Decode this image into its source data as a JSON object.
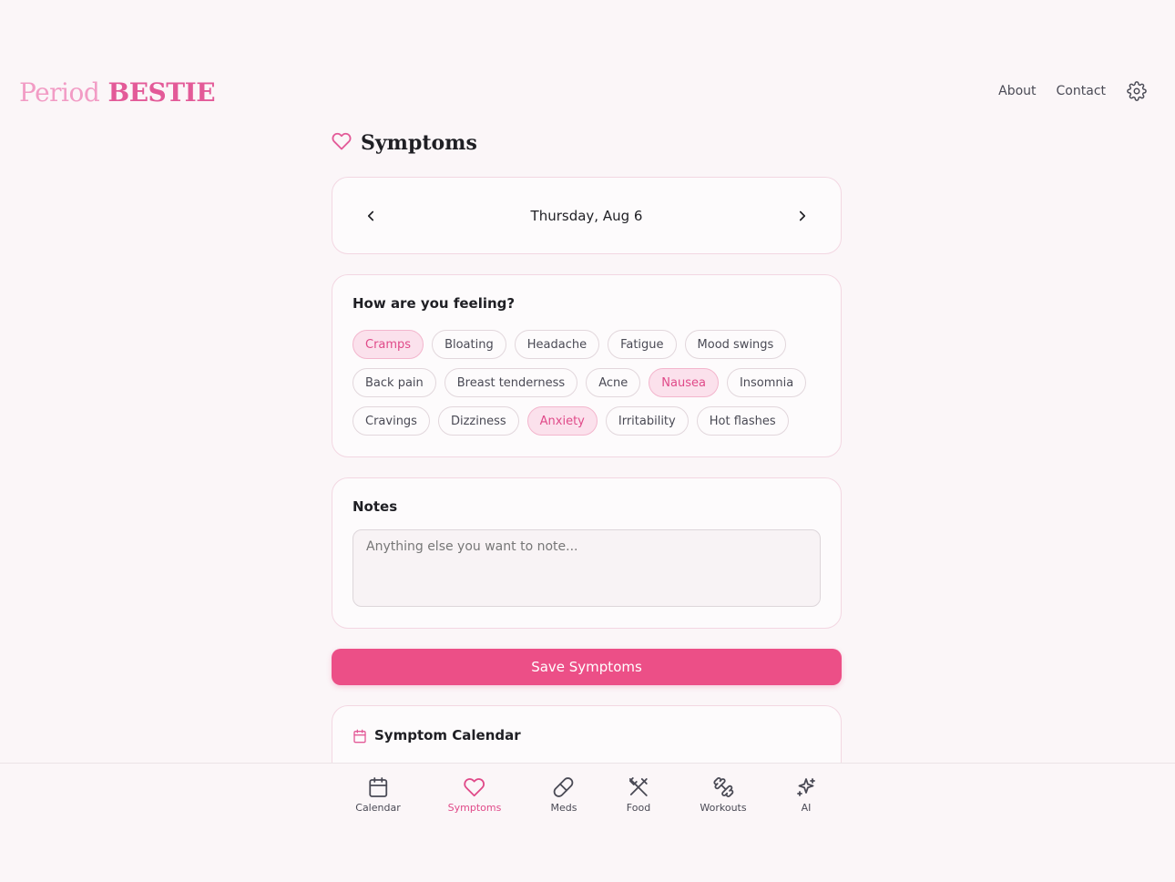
{
  "brand": {
    "part1": "Period",
    "part2": "BESTIE"
  },
  "topnav": {
    "about": "About",
    "contact": "Contact"
  },
  "page": {
    "title": "Symptoms"
  },
  "date_picker": {
    "date": "Thursday, Aug 6"
  },
  "feeling": {
    "title": "How are you feeling?",
    "symptoms": [
      {
        "label": "Cramps",
        "selected": true
      },
      {
        "label": "Bloating",
        "selected": false
      },
      {
        "label": "Headache",
        "selected": false
      },
      {
        "label": "Fatigue",
        "selected": false
      },
      {
        "label": "Mood swings",
        "selected": false
      },
      {
        "label": "Back pain",
        "selected": false
      },
      {
        "label": "Breast tenderness",
        "selected": false
      },
      {
        "label": "Acne",
        "selected": false
      },
      {
        "label": "Nausea",
        "selected": true
      },
      {
        "label": "Insomnia",
        "selected": false
      },
      {
        "label": "Cravings",
        "selected": false
      },
      {
        "label": "Dizziness",
        "selected": false
      },
      {
        "label": "Anxiety",
        "selected": true
      },
      {
        "label": "Irritability",
        "selected": false
      },
      {
        "label": "Hot flashes",
        "selected": false
      }
    ]
  },
  "notes": {
    "title": "Notes",
    "placeholder": "Anything else you want to note...",
    "value": ""
  },
  "save_button": {
    "label": "Save Symptoms"
  },
  "symptom_calendar": {
    "title": "Symptom Calendar"
  },
  "bottom_nav": [
    {
      "label": "Calendar",
      "icon": "calendar-icon",
      "active": false
    },
    {
      "label": "Symptoms",
      "icon": "heart-icon",
      "active": true
    },
    {
      "label": "Meds",
      "icon": "pill-icon",
      "active": false
    },
    {
      "label": "Food",
      "icon": "utensils-icon",
      "active": false
    },
    {
      "label": "Workouts",
      "icon": "dumbbell-icon",
      "active": false
    },
    {
      "label": "AI",
      "icon": "sparkles-icon",
      "active": false
    }
  ],
  "colors": {
    "accent": "#ec4f87",
    "accent_text": "#e04a89",
    "chip_selected_bg": "#fbe1ec",
    "brand_light": "#f29cc5",
    "brand_dark": "#e35a98",
    "background": "#fbf6f8"
  }
}
